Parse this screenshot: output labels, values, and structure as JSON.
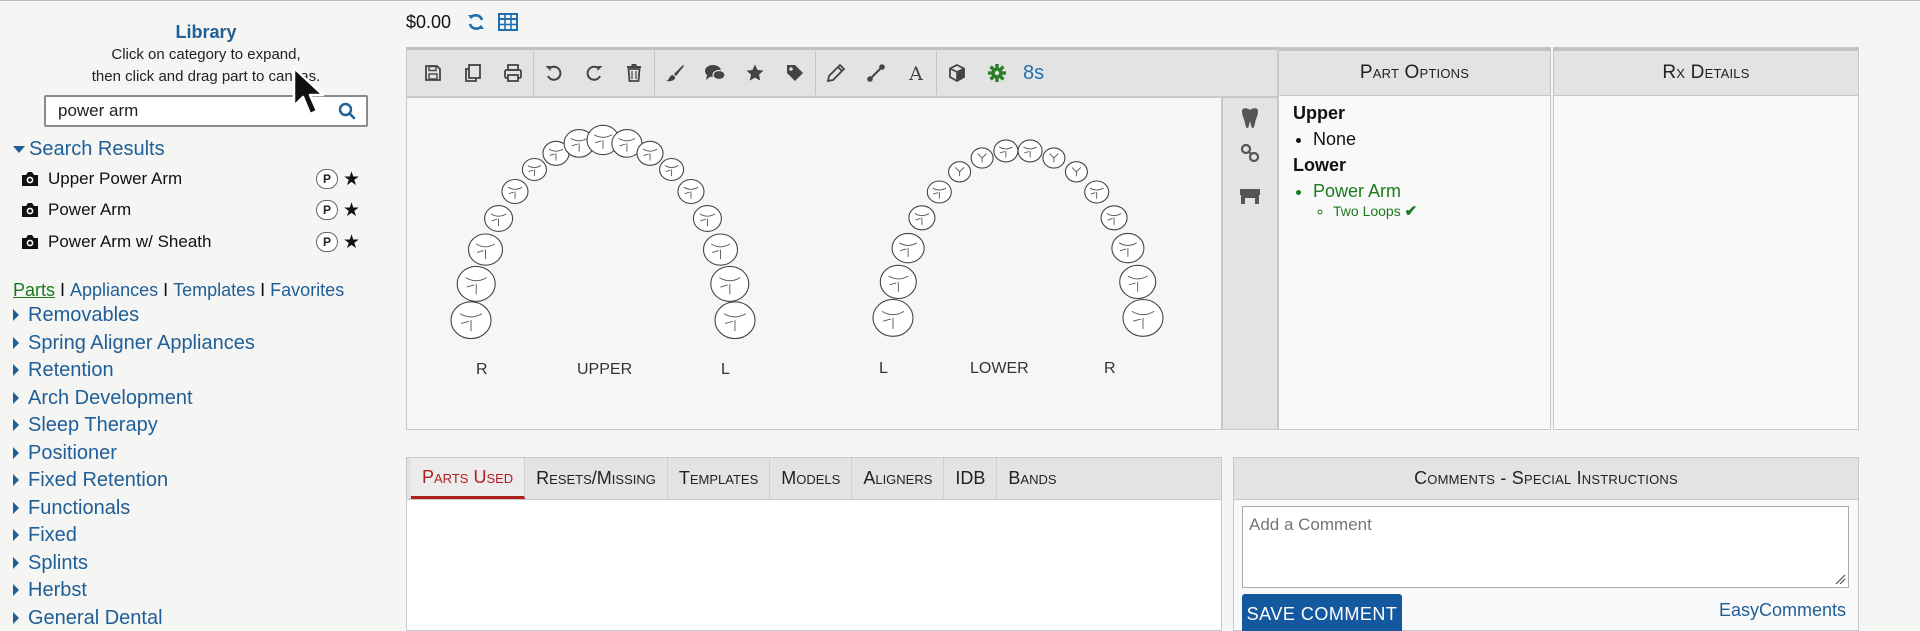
{
  "library": {
    "title": "Library",
    "instructions_line1": "Click on category to expand,",
    "instructions_line2": "then click and drag part to canvas.",
    "search": {
      "value": "power arm",
      "placeholder": ""
    },
    "results_header": "Search Results",
    "results": [
      {
        "label": "Upper Power Arm",
        "badge": "P"
      },
      {
        "label": "Power Arm",
        "badge": "P"
      },
      {
        "label": "Power Arm w/ Sheath",
        "badge": "P"
      }
    ],
    "tabs": [
      "Parts",
      "Appliances",
      "Templates",
      "Favorites"
    ],
    "tab_separator": "I",
    "active_tab": "Parts",
    "categories": [
      "Removables",
      "Spring Aligner Appliances",
      "Retention",
      "Arch Development",
      "Sleep Therapy",
      "Positioner",
      "Fixed Retention",
      "Functionals",
      "Fixed",
      "Splints",
      "Herbst",
      "General Dental"
    ]
  },
  "header": {
    "price": "$0.00",
    "icons": [
      "refresh-icon",
      "grid-table-icon"
    ]
  },
  "toolbar": {
    "icons": [
      "save-icon",
      "copy-icon",
      "print-icon",
      "undo-icon",
      "redo-icon",
      "trash-icon",
      "brush-icon",
      "comment-icon",
      "star-icon",
      "tag-icon",
      "pencil-icon",
      "line-icon",
      "text-icon",
      "cube-icon",
      "gear-icon"
    ],
    "timer": "8s"
  },
  "canvas": {
    "upper": {
      "label": "UPPER",
      "left": "R",
      "right": "L"
    },
    "lower": {
      "label": "LOWER",
      "left": "L",
      "right": "R"
    },
    "side_icons": [
      "tooth-icon",
      "link-icon",
      "bridge-icon"
    ]
  },
  "part_options": {
    "title": "Part Options",
    "upper_label": "Upper",
    "upper_items": [
      "None"
    ],
    "lower_label": "Lower",
    "lower_items": [
      {
        "label": "Power Arm",
        "sub": "Two Loops"
      }
    ],
    "accent": "#1c7a1c"
  },
  "rx_details": {
    "title": "Rx Details"
  },
  "bottom_tabs": {
    "tabs": [
      "Parts Used",
      "Resets/Missing",
      "Templates",
      "Models",
      "Aligners",
      "IDB",
      "Bands"
    ],
    "active": "Parts Used",
    "active_color": "#b01e1e"
  },
  "comments": {
    "title": "Comments - Special Instructions",
    "placeholder": "Add a Comment",
    "save_label": "SAVE COMMENT",
    "easy_comments": "EasyComments",
    "button_color": "#14589f"
  }
}
